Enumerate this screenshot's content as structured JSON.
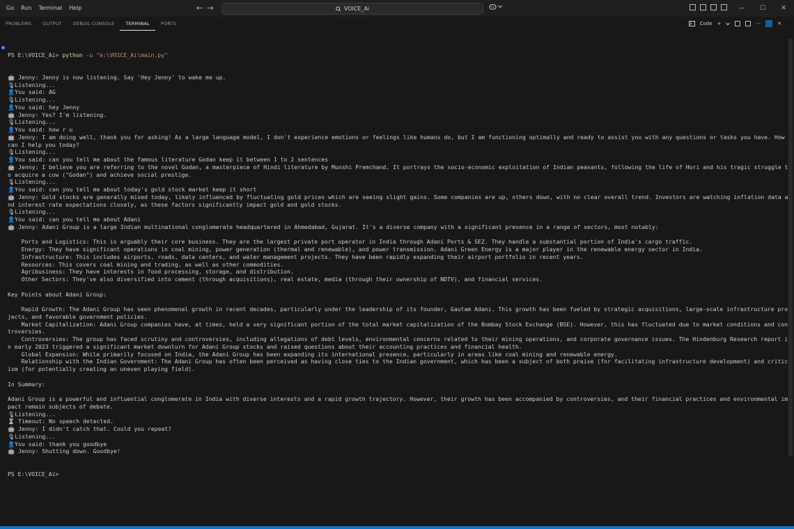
{
  "titlebar": {
    "menu": [
      "Go",
      "Run",
      "Terminal",
      "Help"
    ],
    "back_arrow": "←",
    "forward_arrow": "→",
    "search_text": "VOICE_Ai",
    "window_controls": [
      "—",
      "☐",
      "✕"
    ]
  },
  "panel": {
    "tabs": [
      "PROBLEMS",
      "OUTPUT",
      "DEBUG CONSOLE",
      "TERMINAL",
      "PORTS"
    ],
    "active_tab": "TERMINAL",
    "shell_label": "Code",
    "plus_label": "+"
  },
  "terminal": {
    "prompt": "PS E:\\VOICE_Ai>",
    "command": "python",
    "command_flag": "-u",
    "command_arg": "\"e:\\VOICE_Ai\\main.py\"",
    "lines": [
      "🤖 Jenny: Jenny is now listening. Say 'Hey Jenny' to wake me up.",
      "🎙Listening...",
      "👤You said: AG",
      "🎙Listening...",
      "👤You said: hey Jenny",
      "🤖 Jenny: Yes? I'm listening.",
      "🎙Listening...",
      "👤You said: how r u",
      "🤖 Jenny: I am doing well, thank you for asking! As a large language model, I don't experience emotions or feelings like humans do, but I am functioning optimally and ready to assist you with any questions or tasks you have. How can I help you today?",
      "🎙Listening...",
      "👤You said: can you tell me about the famous literature Godan keep it between 1 to 2 sentences",
      "🤖 Jenny: I believe you are referring to the novel Godan, a masterpiece of Hindi literature by Munshi Premchand. It portrays the socio-economic exploitation of Indian peasants, following the life of Hori and his tragic struggle to acquire a cow (\"Godan\") and achieve social prestige.",
      "🎙Listening...",
      "👤You said: can you tell me about today's gold stock market keep it short",
      "🤖 Jenny: Gold stocks are generally mixed today, likely influenced by fluctuating gold prices which are seeing slight gains. Some companies are up, others down, with no clear overall trend. Investors are watching inflation data and interest rate expectations closely, as these factors significantly impact gold and gold stocks.",
      "🎙Listening...",
      "👤You said: can you tell me about Adani",
      "🤖 Jenny: Adani Group is a large Indian multinational conglomerate headquartered in Ahmedabad, Gujarat. It's a diverse company with a significant presence in a range of sectors, most notably:",
      "",
      "    Ports and Logistics: This is arguably their core business. They are the largest private port operator in India through Adani Ports & SEZ. They handle a substantial portion of India's cargo traffic.",
      "    Energy: They have significant operations in coal mining, power generation (thermal and renewable), and power transmission. Adani Green Energy is a major player in the renewable energy sector in India.",
      "    Infrastructure: This includes airports, roads, data centers, and water management projects. They have been rapidly expanding their airport portfolio in recent years.",
      "    Resources: This covers coal mining and trading, as well as other commodities.",
      "    Agribusiness: They have interests in food processing, storage, and distribution.",
      "    Other Sectors: They've also diversified into cement (through acquisitions), real estate, media (through their ownership of NDTV), and financial services.",
      "",
      "Key Points about Adani Group:",
      "",
      "    Rapid Growth: The Adani Group has seen phenomenal growth in recent decades, particularly under the leadership of its founder, Gautam Adani. This growth has been fueled by strategic acquisitions, large-scale infrastructure projects, and favorable government policies.",
      "    Market Capitalization: Adani Group companies have, at times, held a very significant portion of the total market capitalization of the Bombay Stock Exchange (BSE). However, this has fluctuated due to market conditions and controversies.",
      "    Controversies: The group has faced scrutiny and controversies, including allegations of debt levels, environmental concerns related to their mining operations, and corporate governance issues. The Hindenburg Research report in early 2023 triggered a significant market downturn for Adani Group stocks and raised questions about their accounting practices and financial health.",
      "    Global Expansion: While primarily focused on India, the Adani Group has been expanding its international presence, particularly in areas like coal mining and renewable energy.",
      "    Relationship with the Indian Government: The Adani Group has often been perceived as having close ties to the Indian government, which has been a subject of both praise (for facilitating infrastructure development) and criticism (for potentially creating an uneven playing field).",
      "",
      "In Summary:",
      "",
      "Adani Group is a powerful and influential conglomerate in India with diverse interests and a rapid growth trajectory. However, their growth has been accompanied by controversies, and their financial practices and environmental impact remain subjects of debate.",
      "🎙Listening...",
      "⏳ Timeout: No speech detected.",
      "🤖 Jenny: I didn't catch that. Could you repeat?",
      "🎙Listening...",
      "👤You said: thank you goodbye",
      "🤖 Jenny: Shutting down. Goodbye!"
    ],
    "final_prompt": "PS E:\\VOICE_Ai>"
  },
  "colors": {
    "background": "#181818",
    "accent": "#0078d4",
    "command": "#dcdcaa",
    "string": "#ce9178"
  }
}
